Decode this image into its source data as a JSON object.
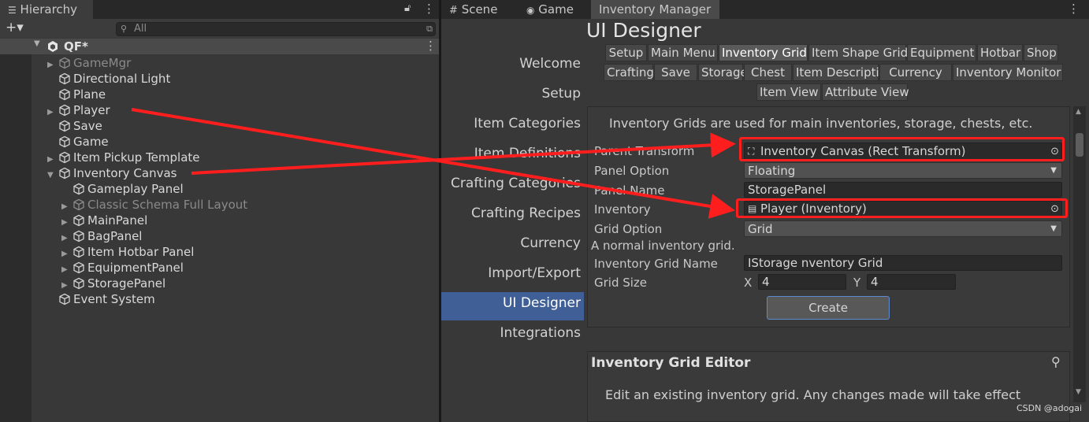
{
  "hierarchy": {
    "tab_label": "Hierarchy",
    "add_label": "+▾",
    "search_placeholder": "All",
    "scene_name": "QF*",
    "items": [
      {
        "label": "GameMgr",
        "dim": true,
        "fold": "▶"
      },
      {
        "label": "Directional Light",
        "dim": false,
        "fold": ""
      },
      {
        "label": "Plane",
        "dim": false,
        "fold": ""
      },
      {
        "label": "Player",
        "dim": false,
        "fold": "▶"
      },
      {
        "label": "Save",
        "dim": false,
        "fold": ""
      },
      {
        "label": "Game",
        "dim": false,
        "fold": ""
      },
      {
        "label": "Item Pickup Template",
        "dim": false,
        "fold": "▶"
      },
      {
        "label": "Inventory Canvas",
        "dim": false,
        "fold": "▼"
      },
      {
        "label": "Gameplay Panel",
        "dim": false,
        "fold": ""
      },
      {
        "label": "Classic Schema Full Layout",
        "dim": true,
        "fold": "▶"
      },
      {
        "label": "MainPanel",
        "dim": false,
        "fold": "▶"
      },
      {
        "label": "BagPanel",
        "dim": false,
        "fold": "▶"
      },
      {
        "label": "Item Hotbar Panel",
        "dim": false,
        "fold": "▶"
      },
      {
        "label": "EquipmentPanel",
        "dim": false,
        "fold": "▶"
      },
      {
        "label": "StoragePanel",
        "dim": false,
        "fold": "▶"
      },
      {
        "label": "Event System",
        "dim": false,
        "fold": ""
      }
    ]
  },
  "top_tabs": {
    "scene": "Scene",
    "game": "Game",
    "inventory_manager": "Inventory Manager"
  },
  "nav": {
    "items": [
      "Welcome",
      "Setup",
      "Item Categories",
      "Item Definitions",
      "Crafting Categories",
      "Crafting Recipes",
      "Currency",
      "Import/Export",
      "UI Designer",
      "Integrations"
    ],
    "selected": "UI Designer"
  },
  "designer": {
    "title": "UI Designer",
    "tabs_row1": [
      "Setup",
      "Main Menu",
      "Inventory Grid",
      "Item Shape Grid",
      "Equipment",
      "Hotbar",
      "Shop"
    ],
    "tabs_row2": [
      "Crafting",
      "Save",
      "Storage",
      "Chest",
      "Item Description",
      "Currency",
      "Inventory Monitor"
    ],
    "tabs_row3": [
      "Item View",
      "Attribute View"
    ],
    "selected_tab": "Inventory Grid",
    "intro": "Inventory Grids are used for main inventories, storage, chests, etc.",
    "fields": {
      "parent_transform_label": "Parent Transform",
      "parent_transform_value": "Inventory Canvas (Rect Transform)",
      "panel_option_label": "Panel Option",
      "panel_option_value": "Floating",
      "panel_name_label": "Panel Name",
      "panel_name_value": "StoragePanel",
      "inventory_label": "Inventory",
      "inventory_value": "Player (Inventory)",
      "grid_option_label": "Grid Option",
      "grid_option_value": "Grid",
      "grid_option_help": "A normal inventory grid.",
      "grid_name_label": "Inventory Grid Name",
      "grid_name_value": "IStorage nventory Grid",
      "grid_size_label": "Grid Size",
      "x_label": "X",
      "x_value": "4",
      "y_label": "Y",
      "y_value": "4"
    },
    "create_label": "Create",
    "editor_title": "Inventory Grid Editor",
    "editor_text": "Edit an existing inventory grid. Any changes made will take effect"
  },
  "watermark": "CSDN @adogai",
  "colors": {
    "annotation": "#ff1e1e",
    "selection": "#3f5f96"
  }
}
